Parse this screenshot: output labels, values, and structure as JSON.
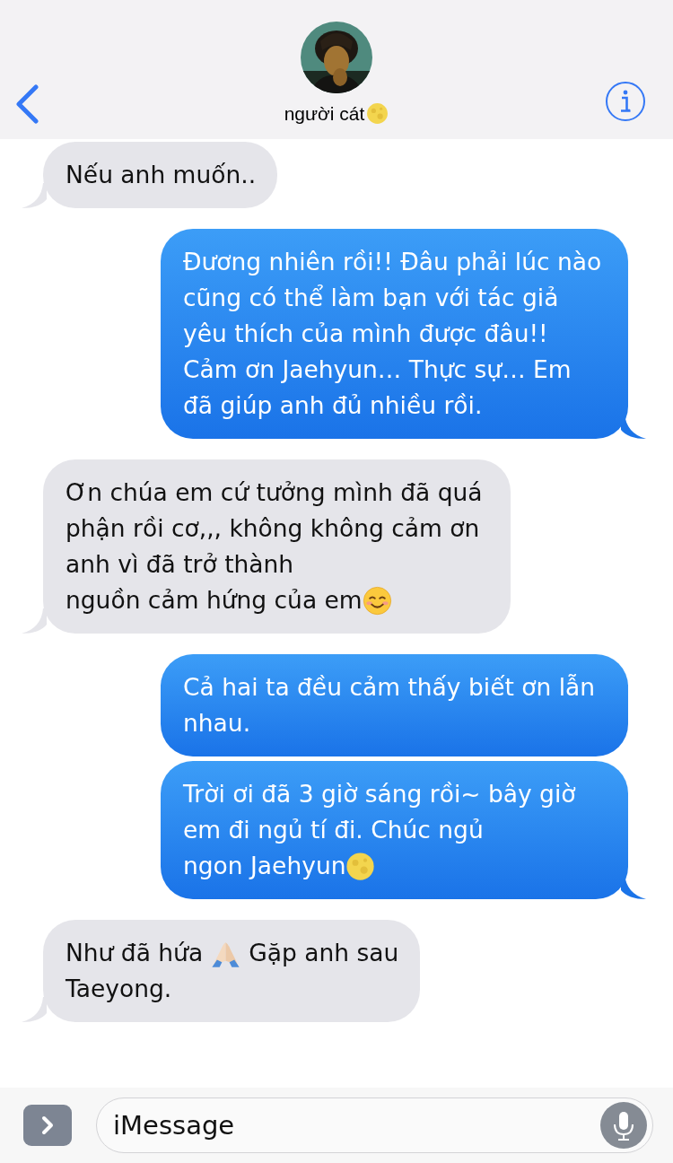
{
  "header": {
    "contact_name": "người cát",
    "contact_emoji": [
      {
        "kind": "moon"
      }
    ]
  },
  "messages": [
    {
      "kind": "received",
      "tail": true,
      "blocks": [
        [
          {
            "kind": "text",
            "text": "Nếu anh muốn.."
          }
        ]
      ]
    },
    {
      "kind": "sent",
      "tail": true,
      "blocks": [
        [
          {
            "kind": "text",
            "text": "Đương nhiên rồi!! Đâu phải lúc nào cũng có thể làm bạn với tác giả yêu thích của mình được đâu!! Cảm ơn Jaehyun… Thực sự… Em đã giúp anh đủ nhiều rồi."
          }
        ]
      ]
    },
    {
      "kind": "received",
      "tail": true,
      "blocks": [
        [
          {
            "kind": "text",
            "text": "Ơn chúa em cứ tưởng mình đã quá phận rồi cơ,,, không không cảm ơn anh vì đã trở thành"
          }
        ],
        [
          {
            "kind": "text",
            "text": "nguồn cảm hứng của em"
          },
          {
            "kind": "smile"
          }
        ]
      ]
    },
    {
      "kind": "sent",
      "tail": false,
      "blocks": [
        [
          {
            "kind": "text",
            "text": "Cả hai ta đều cảm thấy biết ơn lẫn nhau."
          }
        ]
      ]
    },
    {
      "kind": "sent",
      "tail": true,
      "blocks": [
        [
          {
            "kind": "text",
            "text": "Trời ơi đã 3 giờ sáng rồi~ bây giờ em đi ngủ tí đi. Chúc ngủ"
          }
        ],
        [
          {
            "kind": "text",
            "text": "ngon Jaehyun"
          },
          {
            "kind": "moon"
          }
        ]
      ]
    },
    {
      "kind": "received",
      "tail": true,
      "blocks": [
        [
          {
            "kind": "text",
            "text": "Như đã hứa"
          },
          {
            "kind": "hands"
          },
          {
            "kind": "text",
            "text": "Gặp anh sau"
          }
        ],
        [
          {
            "kind": "text",
            "text": "Taeyong."
          }
        ]
      ]
    }
  ],
  "composer": {
    "placeholder": "iMessage"
  }
}
